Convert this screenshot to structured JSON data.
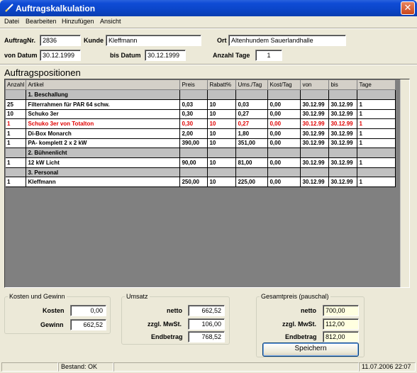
{
  "window": {
    "title": "Auftragskalkulation",
    "close_glyph": "✕"
  },
  "menu": [
    "Datei",
    "Bearbeiten",
    "Hinzufügen",
    "Ansicht"
  ],
  "header": {
    "auftrag_label": "AuftragNr.",
    "auftrag_value": "2836",
    "kunde_label": "Kunde",
    "kunde_value": "Kleffmann",
    "ort_label": "Ort",
    "ort_value": "Altenhundem Sauerlandhalle",
    "von_label": "von Datum",
    "von_value": "30.12.1999",
    "bis_label": "bis Datum",
    "bis_value": "30.12.1999",
    "tage_label": "Anzahl Tage",
    "tage_value": "1"
  },
  "positions": {
    "title": "Auftragspositionen",
    "columns": [
      "Anzahl",
      "Artikel",
      "Preis",
      "Rabatt%",
      "Ums./Tag",
      "Kost/Tag",
      "von",
      "bis",
      "Tage"
    ],
    "rows": [
      {
        "type": "group",
        "artikel": "1. Beschallung"
      },
      {
        "type": "item",
        "anzahl": "25",
        "artikel": "Filterrahmen für PAR 64 schw.",
        "preis": "0,03",
        "rabatt": "10",
        "ums": "0,03",
        "kost": "0,00",
        "von": "30.12.99",
        "bis": "30.12.99",
        "tage": "1"
      },
      {
        "type": "item",
        "anzahl": "10",
        "artikel": "Schuko 3er",
        "preis": "0,30",
        "rabatt": "10",
        "ums": "0,27",
        "kost": "0,00",
        "von": "30.12.99",
        "bis": "30.12.99",
        "tage": "1"
      },
      {
        "type": "item",
        "highlight": true,
        "anzahl": "1",
        "artikel": "Schuko 3er von Totalton",
        "preis": "0,30",
        "rabatt": "10",
        "ums": "0,27",
        "kost": "0,00",
        "von": "30.12.99",
        "bis": "30.12.99",
        "tage": "1"
      },
      {
        "type": "item",
        "anzahl": "1",
        "artikel": "Di-Box Monarch",
        "preis": "2,00",
        "rabatt": "10",
        "ums": "1,80",
        "kost": "0,00",
        "von": "30.12.99",
        "bis": "30.12.99",
        "tage": "1"
      },
      {
        "type": "item",
        "anzahl": "1",
        "artikel": "PA- komplett 2 x 2 kW",
        "preis": "390,00",
        "rabatt": "10",
        "ums": "351,00",
        "kost": "0,00",
        "von": "30.12.99",
        "bis": "30.12.99",
        "tage": "1"
      },
      {
        "type": "group",
        "artikel": "2. Bühnenlicht"
      },
      {
        "type": "item",
        "anzahl": "1",
        "artikel": "12 kW Licht",
        "preis": "90,00",
        "rabatt": "10",
        "ums": "81,00",
        "kost": "0,00",
        "von": "30.12.99",
        "bis": "30.12.99",
        "tage": "1"
      },
      {
        "type": "group",
        "artikel": "3. Personal"
      },
      {
        "type": "item",
        "anzahl": "1",
        "artikel": "Kleffmann",
        "preis": "250,00",
        "rabatt": "10",
        "ums": "225,00",
        "kost": "0,00",
        "von": "30.12.99",
        "bis": "30.12.99",
        "tage": "1"
      }
    ]
  },
  "kosten": {
    "legend": "Kosten und Gewinn",
    "kosten_label": "Kosten",
    "kosten_value": "0,00",
    "gewinn_label": "Gewinn",
    "gewinn_value": "662,52"
  },
  "umsatz": {
    "legend": "Umsatz",
    "netto_label": "netto",
    "netto_value": "662,52",
    "mwst_label": "zzgl. MwSt.",
    "mwst_value": "106,00",
    "end_label": "Endbetrag",
    "end_value": "768,52"
  },
  "gesamt": {
    "legend": "Gesamtpreis (pauschal)",
    "netto_label": "netto",
    "netto_value": "700,00",
    "mwst_label": "zzgl. MwSt.",
    "mwst_value": "112,00",
    "end_label": "Endbetrag",
    "end_value": "812,00",
    "save_label": "Speichern"
  },
  "status": {
    "bestand": "Bestand: OK",
    "datetime": "11.07.2006 22:07"
  },
  "colors": {
    "title_bar": "#0a44c6",
    "highlight_text": "#e00000",
    "group_row": "#c0c0c0",
    "pauschal_field": "#ffffe0"
  }
}
